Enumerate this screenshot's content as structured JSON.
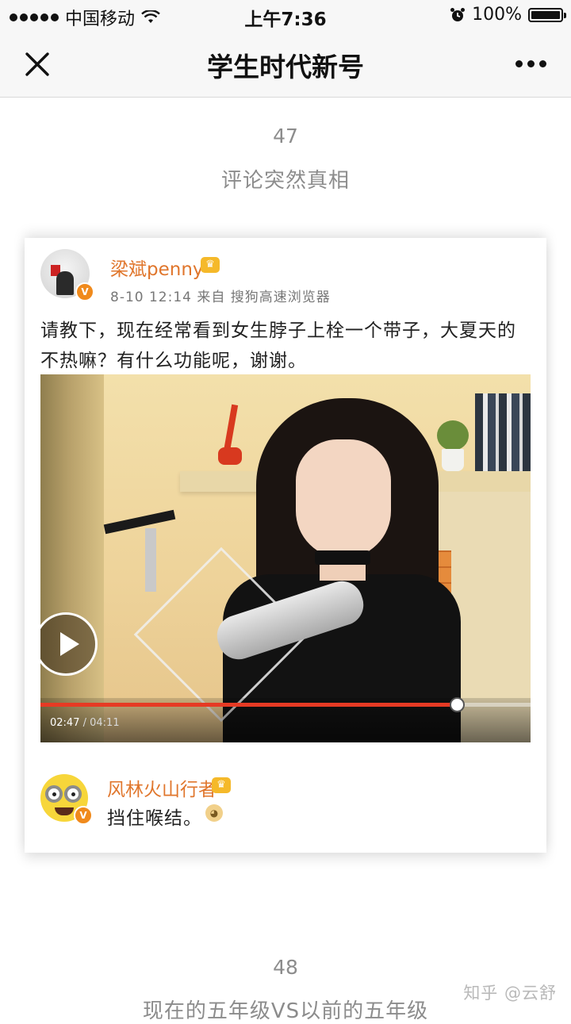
{
  "status_bar": {
    "carrier": "中国移动",
    "time": "上午7:36",
    "battery": "100%",
    "battery_level": 1.0,
    "signal_bars": 5
  },
  "nav": {
    "title": "学生时代新号"
  },
  "sections": [
    {
      "number": "47",
      "title": "评论突然真相"
    },
    {
      "number": "48",
      "title": "现在的五年级VS以前的五年级"
    }
  ],
  "post": {
    "author": "梁斌penny",
    "meta": "8-10 12:14  来自 搜狗高速浏览器",
    "text": "请教下，现在经常看到女生脖子上栓一个带子，大夏天的不热嘛？有什么功能呢，谢谢。",
    "video": {
      "current_time": "02:47",
      "total_time": "/ 04:11",
      "progress": 0.85
    }
  },
  "comment": {
    "author": "风林火山行者",
    "text": "挡住喉结。"
  },
  "watermark": "知乎 @云舒",
  "colors": {
    "username": "#e0762c",
    "progress": "#e63a24",
    "verified_badge": "#f08a1c",
    "muted_text": "#8c8c8c"
  }
}
